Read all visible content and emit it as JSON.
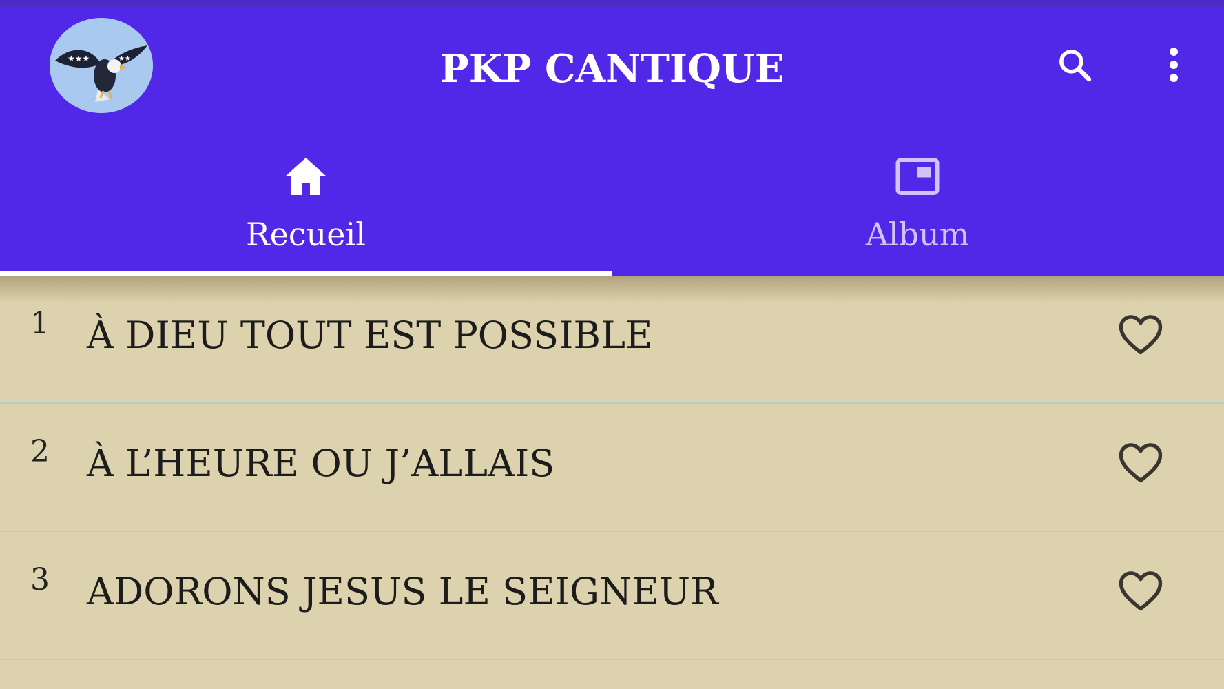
{
  "app": {
    "title": "PKP CANTIQUE",
    "logo_icon": "eagle-flag-logo",
    "colors": {
      "app_bar": "#5127e8",
      "status_strip": "#4a2cc4",
      "background": "#ddd2ae",
      "divider": "#a9d2cf"
    }
  },
  "toolbar": {
    "search_icon": "search-icon",
    "menu_icon": "more-vert-icon"
  },
  "tabs": [
    {
      "label": "Recueil",
      "icon": "home-icon",
      "active": true
    },
    {
      "label": "Album",
      "icon": "picture-in-picture-icon",
      "active": false
    }
  ],
  "songs": [
    {
      "number": "1",
      "title": "À DIEU TOUT EST POSSIBLE",
      "favorite_icon": "heart-outline-icon"
    },
    {
      "number": "2",
      "title": "À L’HEURE OU J’ALLAIS",
      "favorite_icon": "heart-outline-icon"
    },
    {
      "number": "3",
      "title": "ADORONS JESUS LE SEIGNEUR",
      "favorite_icon": "heart-outline-icon"
    }
  ]
}
